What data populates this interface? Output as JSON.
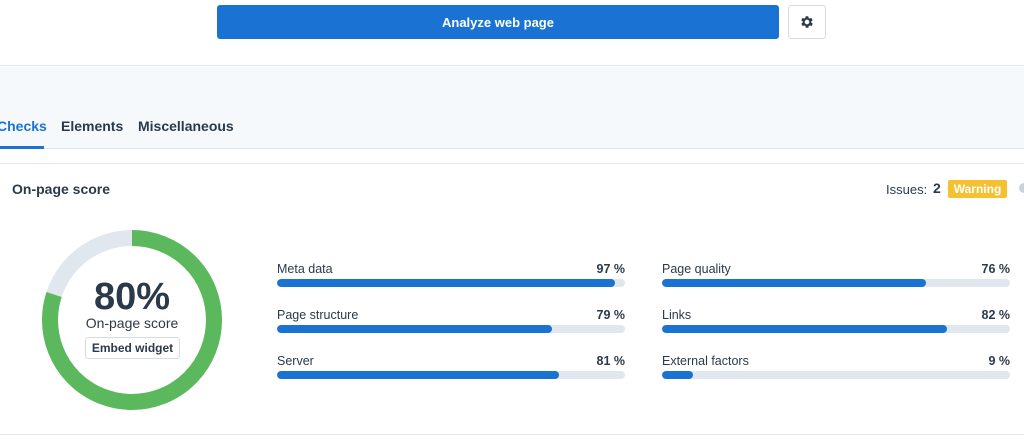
{
  "toolbar": {
    "analyze_label": "Analyze web page",
    "settings_icon": "gear-icon"
  },
  "tabs": [
    {
      "label": "Checks",
      "active": true
    },
    {
      "label": "Elements",
      "active": false
    },
    {
      "label": "Miscellaneous",
      "active": false
    }
  ],
  "score_card": {
    "title": "On-page score",
    "issues_label": "Issues:",
    "issues_count": "2",
    "badge": "Warning",
    "score": 80,
    "score_text": "80%",
    "score_label": "On-page score",
    "embed_label": "Embed widget"
  },
  "metrics": [
    {
      "label": "Meta data",
      "value": 97,
      "value_text": "97 %"
    },
    {
      "label": "Page structure",
      "value": 79,
      "value_text": "79 %"
    },
    {
      "label": "Server",
      "value": 81,
      "value_text": "81 %"
    },
    {
      "label": "Page quality",
      "value": 76,
      "value_text": "76 %"
    },
    {
      "label": "Links",
      "value": 82,
      "value_text": "82 %"
    },
    {
      "label": "External factors",
      "value": 9,
      "value_text": "9 %"
    }
  ],
  "colors": {
    "accent": "#1a73d2",
    "score_green": "#5cb85c",
    "track": "#e1e7ee",
    "warning": "#f4c230"
  }
}
